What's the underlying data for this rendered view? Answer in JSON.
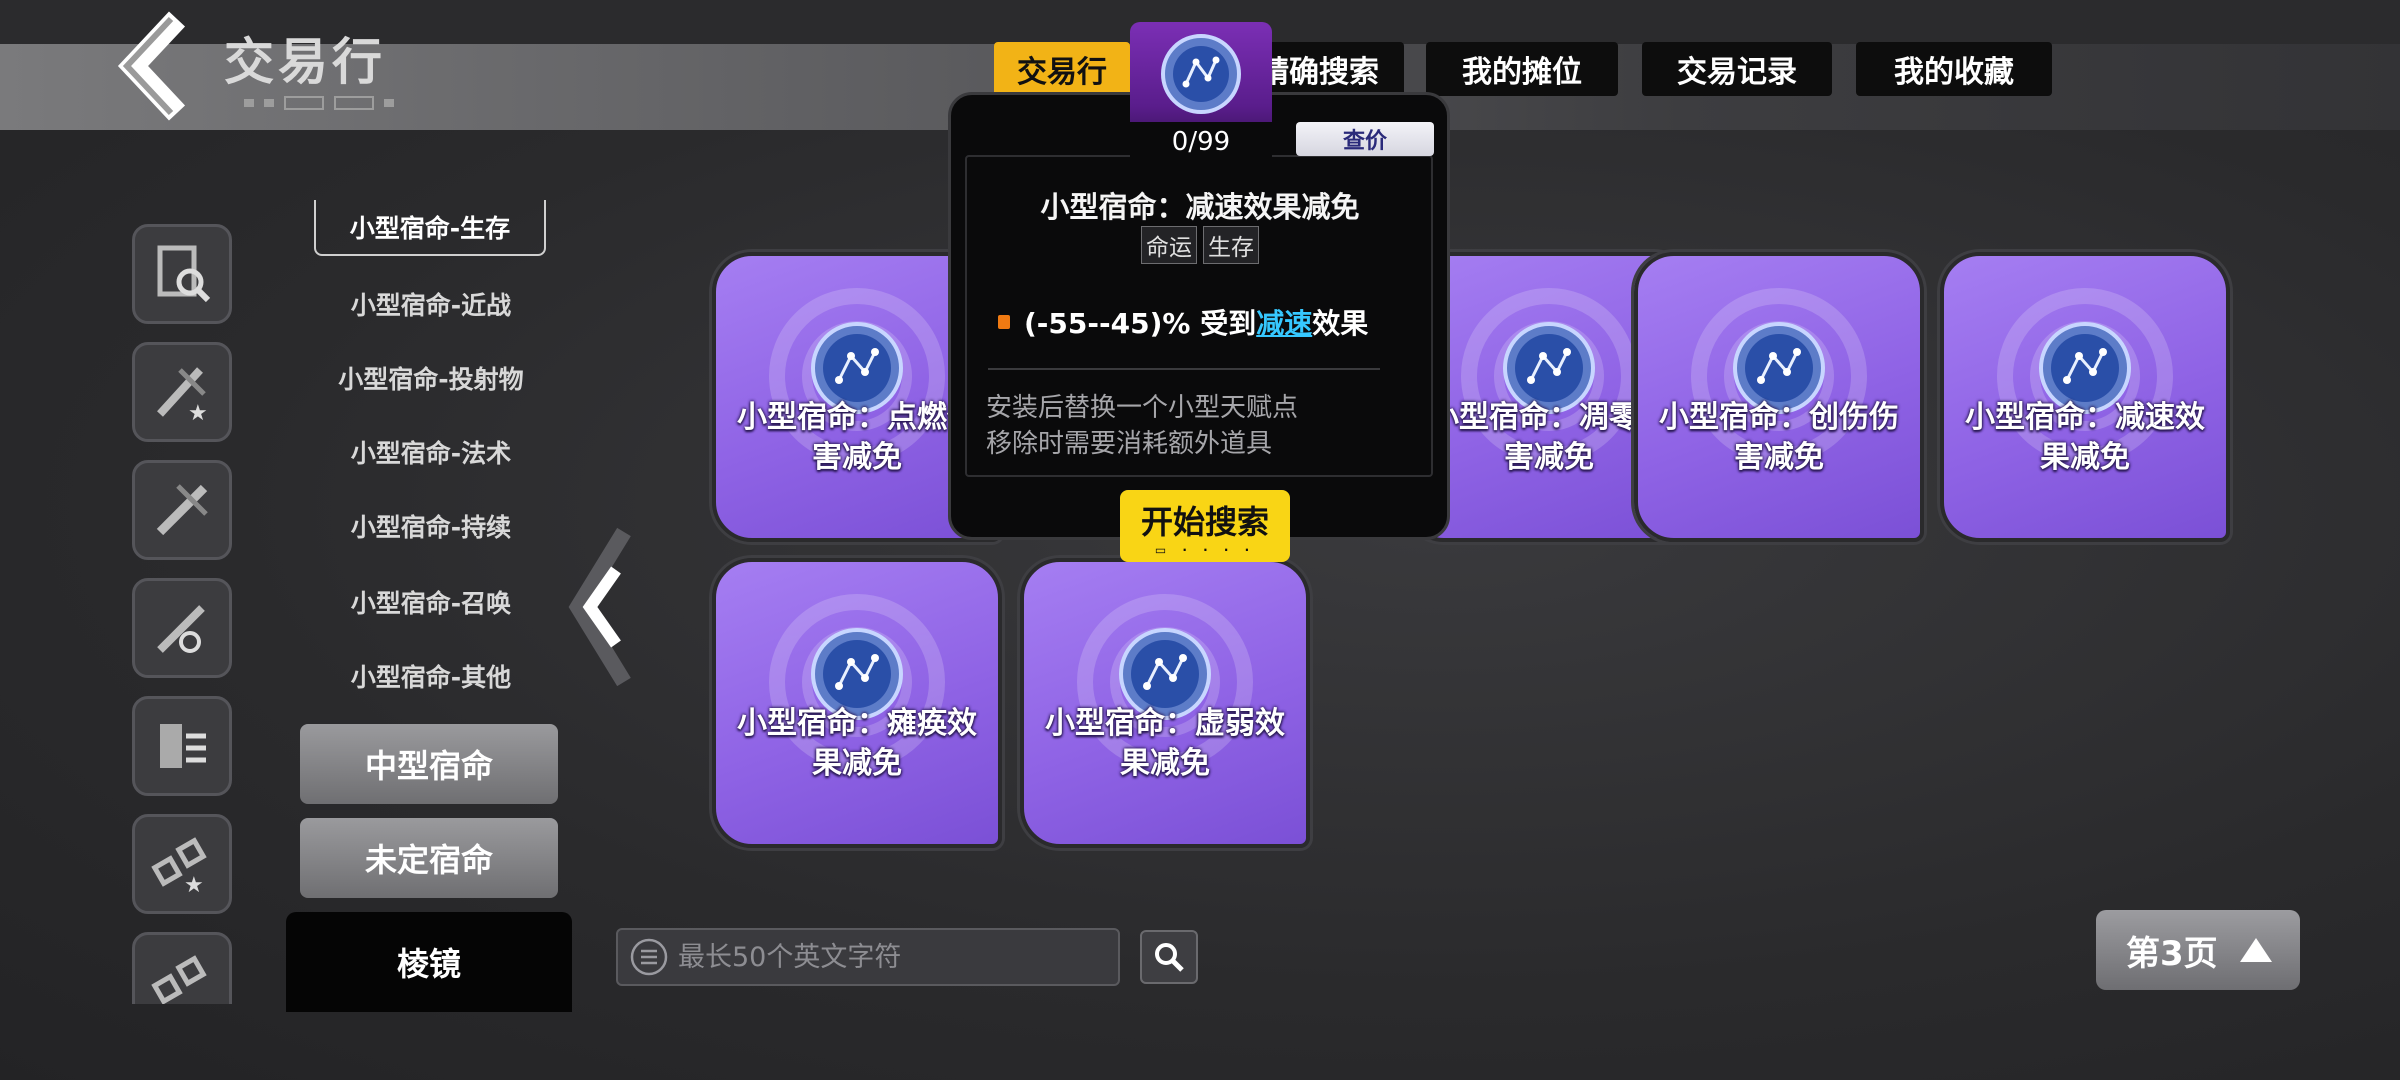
{
  "header": {
    "title": "交易行"
  },
  "tabs": [
    {
      "label": "交易行",
      "active": true
    },
    {
      "label": "精确搜索",
      "active": false
    },
    {
      "label": "我的摊位",
      "active": false
    },
    {
      "label": "交易记录",
      "active": false
    },
    {
      "label": "我的收藏",
      "active": false
    }
  ],
  "categories": {
    "items": [
      "小型宿命-生存",
      "小型宿命-近战",
      "小型宿命-投射物",
      "小型宿命-法术",
      "小型宿命-持续",
      "小型宿命-召唤",
      "小型宿命-其他"
    ],
    "medium": "中型宿命",
    "undecided": "未定宿命",
    "prism": "棱镜"
  },
  "cards": [
    {
      "name": "小型宿命：点燃伤害减免"
    },
    {
      "name": "小型宿命：凋零伤害减免"
    },
    {
      "name": "小型宿命：创伤伤害减免"
    },
    {
      "name": "小型宿命：减速效果减免"
    },
    {
      "name": "小型宿命：瘫痪效果减免"
    },
    {
      "name": "小型宿命：虚弱效果减免"
    }
  ],
  "popup": {
    "count": "0/99",
    "price_button": "查价",
    "title": "小型宿命：减速效果减免",
    "tags": [
      "命运",
      "生存"
    ],
    "affix_prefix": "(-55--45)% 受到",
    "affix_keyword": "减速",
    "affix_suffix": "效果",
    "desc_line1": "安装后替换一个小型天赋点",
    "desc_line2": "移除时需要消耗额外道具",
    "search_button": "开始搜索"
  },
  "search": {
    "placeholder": "最长50个英文字符"
  },
  "pager": {
    "label": "第3页"
  },
  "colors": {
    "accent_yellow": "#f9d515",
    "tab_active": "#f2b316",
    "card_purple": "#9a70ec",
    "keyword_blue": "#36c8ff",
    "bullet_orange": "#f07a12"
  }
}
